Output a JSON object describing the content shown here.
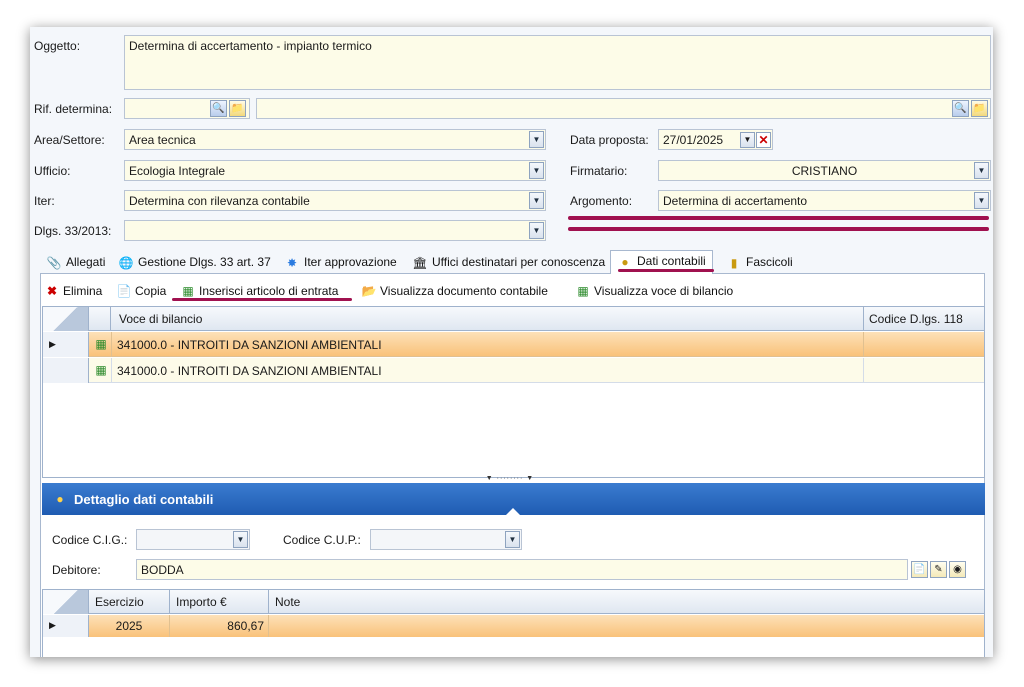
{
  "form": {
    "oggetto_label": "Oggetto:",
    "oggetto_value": "Determina di accertamento - impianto termico",
    "rif_label": "Rif. determina:",
    "area_label": "Area/Settore:",
    "area_value": "Area tecnica",
    "ufficio_label": "Ufficio:",
    "ufficio_value": "Ecologia Integrale",
    "iter_label": "Iter:",
    "iter_value": "Determina con rilevanza contabile",
    "dlgs_label": "Dlgs. 33/2013:",
    "dlgs_value": "",
    "data_label": "Data proposta:",
    "data_value": "27/01/2025",
    "firmatario_label": "Firmatario:",
    "firmatario_value": "CRISTIANO",
    "argomento_label": "Argomento:",
    "argomento_value": "Determina di accertamento"
  },
  "tabs": [
    {
      "label": "Allegati",
      "icon": "paperclip-icon"
    },
    {
      "label": "Gestione Dlgs. 33 art. 37",
      "icon": "globe-icon"
    },
    {
      "label": "Iter approvazione",
      "icon": "workflow-icon"
    },
    {
      "label": "Uffici destinatari per conoscenza",
      "icon": "building-icon"
    },
    {
      "label": "Dati contabili",
      "icon": "coins-icon"
    },
    {
      "label": "Fascicoli",
      "icon": "folder-stack-icon"
    }
  ],
  "toolbar": {
    "elimina": "Elimina",
    "copia": "Copia",
    "inserisci": "Inserisci articolo di entrata",
    "visualizza_doc": "Visualizza documento contabile",
    "visualizza_voce": "Visualizza voce di bilancio"
  },
  "voci_grid": {
    "headers": [
      "Voce di bilancio",
      "Codice D.lgs. 118"
    ],
    "rows": [
      {
        "voce": "341000.0 - INTROITI DA SANZIONI AMBIENTALI",
        "codice": ""
      },
      {
        "voce": "341000.0 - INTROITI DA SANZIONI AMBIENTALI",
        "codice": ""
      }
    ]
  },
  "dettaglio": {
    "title": "Dettaglio dati contabili",
    "cig_label": "Codice C.I.G.:",
    "cig_value": "",
    "cup_label": "Codice C.U.P.:",
    "cup_value": "",
    "debitore_label": "Debitore:",
    "debitore_value": "BODDA"
  },
  "importi_grid": {
    "headers": [
      "Esercizio",
      "Importo €",
      "Note"
    ],
    "rows": [
      {
        "esercizio": "2025",
        "importo": "860,67",
        "note": ""
      }
    ]
  },
  "colors": {
    "underline": "#a0114f",
    "selected_row": "#f9c27a",
    "panel_header": "#1f5cb2",
    "field_bg": "#fdfce8"
  }
}
